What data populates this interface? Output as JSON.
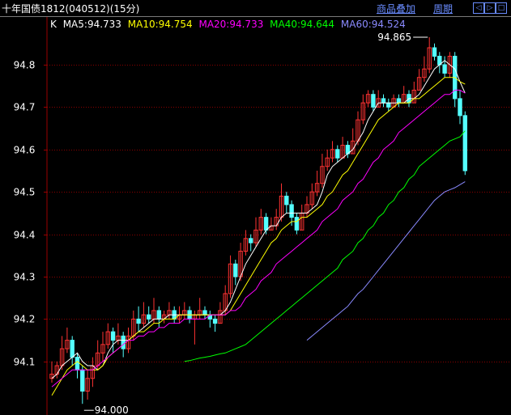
{
  "header": {
    "title": "十年国债1812(040512)(15分)",
    "overlay_label": "商品叠加",
    "period_label": "周期",
    "nav_left": "◁",
    "nav_right": "▷",
    "nav_box": "□"
  },
  "colors": {
    "background": "#000000",
    "up": "#ff3232",
    "down": "#54ffff",
    "grid": "#8b0000",
    "axis": "#9a0000",
    "ma5": "#ffffff",
    "ma10": "#ffff00",
    "ma20": "#ff00ff",
    "ma40": "#00ff00",
    "ma60": "#8a8aff"
  },
  "legend": {
    "k": "K",
    "ma5": "MA5:94.733",
    "ma10": "MA10:94.754",
    "ma20": "MA20:94.733",
    "ma40": "MA40:94.644",
    "ma60": "MA60:94.524"
  },
  "chart_data": {
    "type": "candlestick",
    "ylim": [
      94.0,
      94.85
    ],
    "yticks": [
      94.1,
      94.2,
      94.3,
      94.4,
      94.5,
      94.6,
      94.7,
      94.8
    ],
    "ytick_labels": [
      "94.1",
      "94.2",
      "94.3",
      "94.4",
      "94.5",
      "94.6",
      "94.7",
      "94.8"
    ],
    "annotations": {
      "high": "94.865",
      "low": "94.000"
    },
    "candles": [
      [
        94.06,
        94.07,
        94.1,
        94.05
      ],
      [
        94.07,
        94.09,
        94.1,
        94.06
      ],
      [
        94.09,
        94.13,
        94.16,
        94.08
      ],
      [
        94.13,
        94.15,
        94.18,
        94.12
      ],
      [
        94.15,
        94.11,
        94.16,
        94.09
      ],
      [
        94.11,
        94.08,
        94.12,
        94.06
      ],
      [
        94.08,
        94.03,
        94.09,
        94.0
      ],
      [
        94.03,
        94.06,
        94.08,
        94.01
      ],
      [
        94.06,
        94.09,
        94.11,
        94.04
      ],
      [
        94.09,
        94.12,
        94.15,
        94.08
      ],
      [
        94.12,
        94.14,
        94.17,
        94.1
      ],
      [
        94.14,
        94.17,
        94.19,
        94.13
      ],
      [
        94.17,
        94.15,
        94.18,
        94.12
      ],
      [
        94.15,
        94.16,
        94.19,
        94.14
      ],
      [
        94.16,
        94.13,
        94.17,
        94.11
      ],
      [
        94.13,
        94.16,
        94.18,
        94.12
      ],
      [
        94.16,
        94.2,
        94.22,
        94.15
      ],
      [
        94.2,
        94.19,
        94.23,
        94.17
      ],
      [
        94.19,
        94.21,
        94.24,
        94.18
      ],
      [
        94.21,
        94.2,
        94.23,
        94.19
      ],
      [
        94.2,
        94.22,
        94.25,
        94.19
      ],
      [
        94.22,
        94.2,
        94.23,
        94.18
      ],
      [
        94.2,
        94.21,
        94.22,
        94.19
      ],
      [
        94.21,
        94.22,
        94.24,
        94.2
      ],
      [
        94.22,
        94.2,
        94.23,
        94.19
      ],
      [
        94.2,
        94.21,
        94.23,
        94.19
      ],
      [
        94.21,
        94.22,
        94.24,
        94.2
      ],
      [
        94.22,
        94.2,
        94.23,
        94.19
      ],
      [
        94.2,
        94.21,
        94.22,
        94.14
      ],
      [
        94.21,
        94.22,
        94.25,
        94.2
      ],
      [
        94.22,
        94.21,
        94.23,
        94.2
      ],
      [
        94.21,
        94.2,
        94.22,
        94.18
      ],
      [
        94.2,
        94.19,
        94.21,
        94.17
      ],
      [
        94.19,
        94.22,
        94.24,
        94.19
      ],
      [
        94.22,
        94.26,
        94.28,
        94.21
      ],
      [
        94.26,
        94.33,
        94.35,
        94.25
      ],
      [
        94.33,
        94.3,
        94.34,
        94.28
      ],
      [
        94.3,
        94.36,
        94.38,
        94.29
      ],
      [
        94.36,
        94.39,
        94.41,
        94.35
      ],
      [
        94.39,
        94.38,
        94.4,
        94.36
      ],
      [
        94.38,
        94.41,
        94.44,
        94.37
      ],
      [
        94.41,
        94.44,
        94.46,
        94.4
      ],
      [
        94.44,
        94.41,
        94.45,
        94.4
      ],
      [
        94.41,
        94.42,
        94.44,
        94.41
      ],
      [
        94.42,
        94.44,
        94.46,
        94.41
      ],
      [
        94.44,
        94.49,
        94.52,
        94.43
      ],
      [
        94.49,
        94.47,
        94.5,
        94.45
      ],
      [
        94.47,
        94.44,
        94.48,
        94.42
      ],
      [
        94.44,
        94.41,
        94.45,
        94.4
      ],
      [
        94.41,
        94.45,
        94.47,
        94.41
      ],
      [
        94.45,
        94.47,
        94.49,
        94.44
      ],
      [
        94.47,
        94.5,
        94.52,
        94.46
      ],
      [
        94.5,
        94.52,
        94.55,
        94.49
      ],
      [
        94.52,
        94.56,
        94.59,
        94.51
      ],
      [
        94.56,
        94.58,
        94.6,
        94.55
      ],
      [
        94.58,
        94.6,
        94.62,
        94.57
      ],
      [
        94.6,
        94.58,
        94.61,
        94.57
      ],
      [
        94.58,
        94.61,
        94.63,
        94.58
      ],
      [
        94.61,
        94.59,
        94.62,
        94.58
      ],
      [
        94.59,
        94.62,
        94.65,
        94.59
      ],
      [
        94.62,
        94.67,
        94.69,
        94.61
      ],
      [
        94.67,
        94.71,
        94.73,
        94.66
      ],
      [
        94.71,
        94.73,
        94.74,
        94.7
      ],
      [
        94.73,
        94.7,
        94.74,
        94.69
      ],
      [
        94.7,
        94.72,
        94.74,
        94.7
      ],
      [
        94.72,
        94.71,
        94.73,
        94.7
      ],
      [
        94.71,
        94.7,
        94.72,
        94.69
      ],
      [
        94.7,
        94.72,
        94.73,
        94.7
      ],
      [
        94.72,
        94.71,
        94.73,
        94.7
      ],
      [
        94.71,
        94.73,
        94.75,
        94.71
      ],
      [
        94.73,
        94.71,
        94.74,
        94.7
      ],
      [
        94.71,
        94.74,
        94.76,
        94.71
      ],
      [
        94.74,
        94.77,
        94.79,
        94.74
      ],
      [
        94.77,
        94.79,
        94.82,
        94.76
      ],
      [
        94.79,
        94.84,
        94.865,
        94.78
      ],
      [
        94.84,
        94.82,
        94.85,
        94.81
      ],
      [
        94.82,
        94.8,
        94.83,
        94.78
      ],
      [
        94.8,
        94.78,
        94.82,
        94.77
      ],
      [
        94.78,
        94.82,
        94.83,
        94.77
      ],
      [
        94.82,
        94.72,
        94.83,
        94.7
      ],
      [
        94.72,
        94.68,
        94.74,
        94.66
      ],
      [
        94.68,
        94.55,
        94.69,
        94.54
      ]
    ],
    "ma": [
      {
        "name": "MA5",
        "color": "#ffffff",
        "start": 0,
        "values": [
          94.06,
          94.07,
          94.09,
          94.1,
          94.11,
          94.12,
          94.1,
          94.09,
          94.09,
          94.08,
          94.09,
          94.12,
          94.14,
          94.15,
          94.15,
          94.15,
          94.16,
          94.17,
          94.18,
          94.19,
          94.2,
          94.2,
          94.2,
          94.21,
          94.21,
          94.21,
          94.21,
          94.21,
          94.21,
          94.21,
          94.21,
          94.21,
          94.21,
          94.21,
          94.22,
          94.24,
          94.27,
          94.3,
          94.33,
          94.35,
          94.37,
          94.39,
          94.41,
          94.42,
          94.42,
          94.44,
          94.45,
          94.45,
          94.45,
          94.45,
          94.45,
          94.46,
          94.47,
          94.5,
          94.54,
          94.56,
          94.57,
          94.58,
          94.59,
          94.6,
          94.62,
          94.64,
          94.67,
          94.69,
          94.71,
          94.71,
          94.71,
          94.71,
          94.71,
          94.71,
          94.72,
          94.72,
          94.73,
          94.75,
          94.77,
          94.79,
          94.8,
          94.81,
          94.8,
          94.79,
          94.76,
          94.733
        ]
      },
      {
        "name": "MA10",
        "color": "#ffff00",
        "start": 0,
        "values": [
          94.02,
          94.04,
          94.06,
          94.08,
          94.09,
          94.1,
          94.09,
          94.08,
          94.08,
          94.08,
          94.09,
          94.11,
          94.12,
          94.13,
          94.14,
          94.15,
          94.16,
          94.17,
          94.17,
          94.18,
          94.19,
          94.19,
          94.2,
          94.2,
          94.2,
          94.21,
          94.21,
          94.21,
          94.21,
          94.21,
          94.21,
          94.21,
          94.21,
          94.21,
          94.21,
          94.22,
          94.24,
          94.26,
          94.28,
          94.3,
          94.32,
          94.34,
          94.36,
          94.38,
          94.39,
          94.41,
          94.42,
          94.43,
          94.43,
          94.44,
          94.44,
          94.45,
          94.46,
          94.47,
          94.49,
          94.5,
          94.52,
          94.54,
          94.55,
          94.57,
          94.59,
          94.61,
          94.63,
          94.65,
          94.67,
          94.68,
          94.69,
          94.7,
          94.71,
          94.71,
          94.71,
          94.72,
          94.72,
          94.73,
          94.74,
          94.75,
          94.76,
          94.77,
          94.77,
          94.77,
          94.76,
          94.754
        ]
      },
      {
        "name": "MA20",
        "color": "#ff00ff",
        "start": 0,
        "values": [
          94.04,
          94.05,
          94.06,
          94.07,
          94.08,
          94.08,
          94.08,
          94.08,
          94.08,
          94.09,
          94.1,
          94.11,
          94.12,
          94.13,
          94.14,
          94.15,
          94.15,
          94.16,
          94.16,
          94.17,
          94.17,
          94.18,
          94.18,
          94.19,
          94.19,
          94.19,
          94.2,
          94.2,
          94.2,
          94.2,
          94.2,
          94.21,
          94.21,
          94.21,
          94.21,
          94.22,
          94.22,
          94.23,
          94.25,
          94.26,
          94.27,
          94.29,
          94.3,
          94.31,
          94.33,
          94.34,
          94.35,
          94.36,
          94.37,
          94.38,
          94.39,
          94.4,
          94.41,
          94.43,
          94.44,
          94.45,
          94.46,
          94.48,
          94.49,
          94.5,
          94.52,
          94.53,
          94.55,
          94.57,
          94.58,
          94.6,
          94.61,
          94.62,
          94.64,
          94.65,
          94.66,
          94.67,
          94.68,
          94.69,
          94.7,
          94.71,
          94.72,
          94.73,
          94.73,
          94.74,
          94.74,
          94.733
        ]
      },
      {
        "name": "MA40",
        "color": "#00ff00",
        "start": 26,
        "values": [
          94.1,
          94.102,
          94.105,
          94.108,
          94.11,
          94.112,
          94.115,
          94.118,
          94.12,
          94.125,
          94.13,
          94.135,
          94.14,
          94.15,
          94.16,
          94.17,
          94.18,
          94.19,
          94.2,
          94.21,
          94.22,
          94.23,
          94.24,
          94.25,
          94.26,
          94.27,
          94.28,
          94.29,
          94.3,
          94.31,
          94.32,
          94.34,
          94.35,
          94.36,
          94.38,
          94.39,
          94.41,
          94.42,
          94.44,
          94.45,
          94.47,
          94.48,
          94.5,
          94.51,
          94.53,
          94.54,
          94.56,
          94.57,
          94.58,
          94.59,
          94.6,
          94.61,
          94.62,
          94.625,
          94.63,
          94.644
        ]
      },
      {
        "name": "MA60",
        "color": "#8a8aff",
        "start": 50,
        "values": [
          94.15,
          94.16,
          94.17,
          94.18,
          94.19,
          94.2,
          94.21,
          94.22,
          94.23,
          94.245,
          94.26,
          94.27,
          94.285,
          94.3,
          94.315,
          94.33,
          94.345,
          94.36,
          94.375,
          94.39,
          94.405,
          94.42,
          94.435,
          94.45,
          94.465,
          94.48,
          94.49,
          94.5,
          94.505,
          94.51,
          94.517,
          94.524
        ]
      }
    ]
  }
}
